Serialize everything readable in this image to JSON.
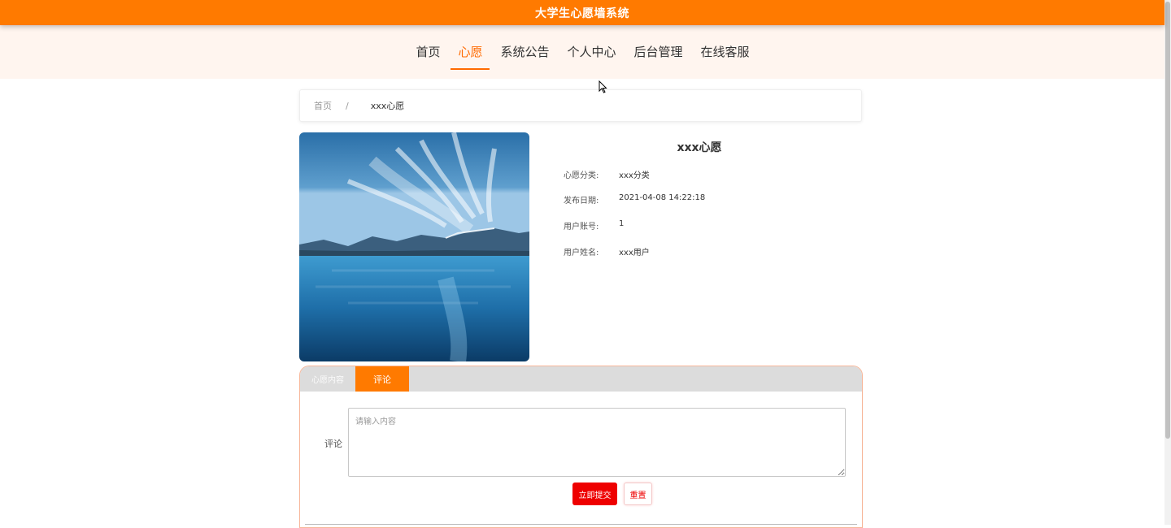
{
  "header": {
    "title": "大学生心愿墙系统"
  },
  "nav": {
    "items": [
      {
        "label": "首页"
      },
      {
        "label": "心愿"
      },
      {
        "label": "系统公告"
      },
      {
        "label": "个人中心"
      },
      {
        "label": "后台管理"
      },
      {
        "label": "在线客服"
      }
    ],
    "active_index": 1
  },
  "breadcrumb": {
    "home": "首页",
    "separator": "/",
    "current": "xxx心愿"
  },
  "detail": {
    "title": "xxx心愿",
    "fields": [
      {
        "label": "心愿分类:",
        "value": "xxx分类"
      },
      {
        "label": "发布日期:",
        "value": "2021-04-08 14:22:18"
      },
      {
        "label": "用户账号:",
        "value": "1"
      },
      {
        "label": "用户姓名:",
        "value": "xxx用户"
      }
    ]
  },
  "tabs": [
    {
      "label": "心愿内容"
    },
    {
      "label": "评论"
    }
  ],
  "comment_form": {
    "label": "评论",
    "placeholder": "请输入内容",
    "value": "",
    "submit_label": "立即提交",
    "reset_label": "重置"
  },
  "colors": {
    "accent": "#ff7a00",
    "nav_bg": "#fff5ef",
    "submit": "#ee0000"
  }
}
